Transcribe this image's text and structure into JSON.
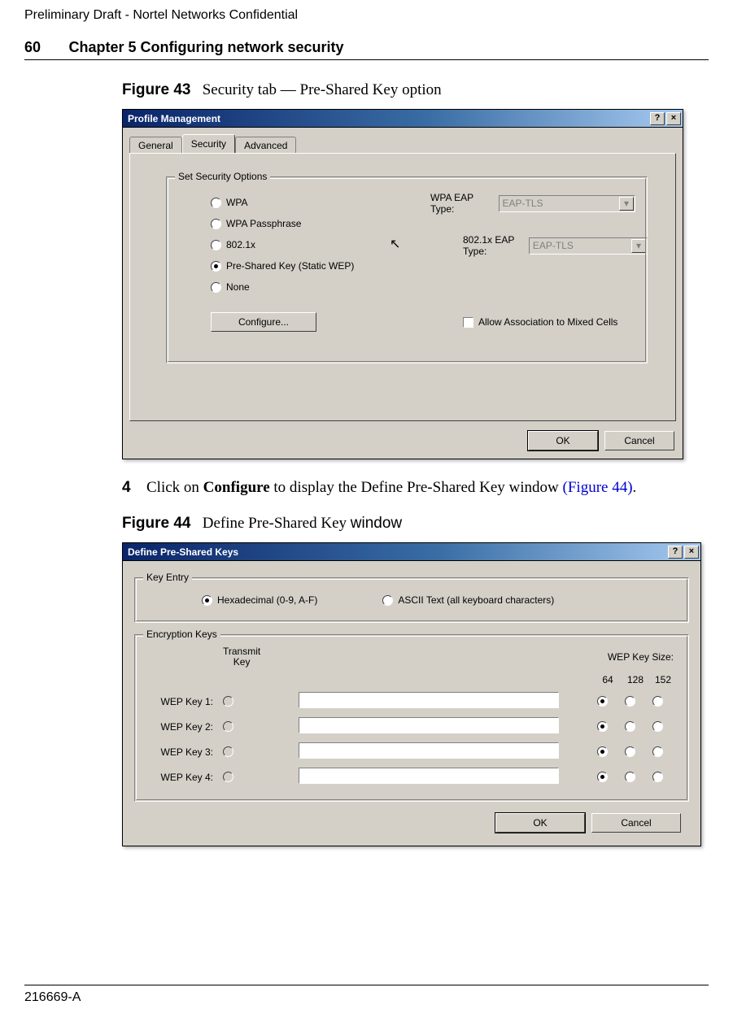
{
  "header": {
    "preliminary": "Preliminary Draft - Nortel Networks Confidential",
    "page_number": "60",
    "chapter_title": "Chapter 5 Configuring network security"
  },
  "figure43": {
    "lead": "Figure 43",
    "caption": "Security tab — Pre-Shared Key option",
    "dialog_title": "Profile Management",
    "help": "?",
    "close": "×",
    "tabs": {
      "general": "General",
      "security": "Security",
      "advanced": "Advanced"
    },
    "group_legend": "Set Security Options",
    "opts": {
      "wpa": "WPA",
      "wpa_pass": "WPA Passphrase",
      "dot1x": "802.1x",
      "psk": "Pre-Shared Key (Static WEP)",
      "none": "None"
    },
    "right": {
      "wpa_eap_lbl": "WPA EAP Type:",
      "wpa_eap_val": "EAP-TLS",
      "dot1x_eap_lbl": "802.1x EAP Type:",
      "dot1x_eap_val": "EAP-TLS"
    },
    "configure_btn": "Configure...",
    "allow_mixed": "Allow Association to Mixed Cells",
    "ok": "OK",
    "cancel": "Cancel"
  },
  "step4": {
    "num": "4",
    "text_a": "Click on ",
    "bold": "Configure",
    "text_b": " to display the Define Pre-Shared Key window ",
    "link": "(Figure 44)",
    "period": "."
  },
  "figure44": {
    "lead": "Figure 44",
    "caption_a": "Define Pre-Shared Key ",
    "caption_b": "window",
    "dialog_title": "Define Pre-Shared Keys",
    "help": "?",
    "close": "×",
    "key_entry_legend": "Key Entry",
    "hex": "Hexadecimal (0-9, A-F)",
    "ascii": "ASCII Text (all keyboard characters)",
    "enc_legend": "Encryption Keys",
    "transmit_hdr1": "Transmit",
    "transmit_hdr2": "Key",
    "wep_size_hdr": "WEP Key Size:",
    "size64": "64",
    "size128": "128",
    "size152": "152",
    "rows": {
      "r1": "WEP Key 1:",
      "r2": "WEP Key 2:",
      "r3": "WEP Key 3:",
      "r4": "WEP Key 4:"
    },
    "ok": "OK",
    "cancel": "Cancel"
  },
  "footer": {
    "doc_id": "216669-A"
  }
}
